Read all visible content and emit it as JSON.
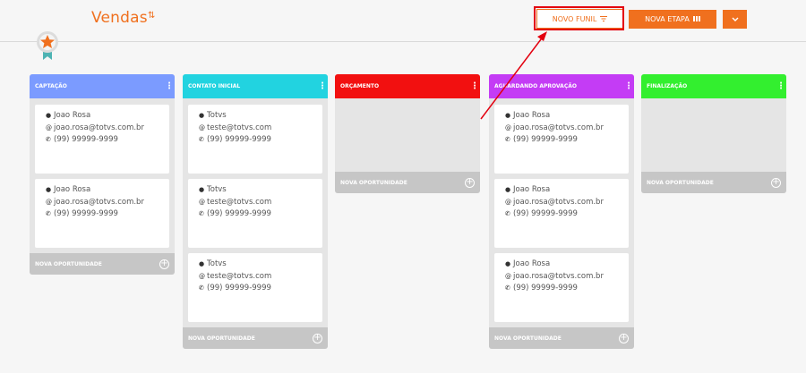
{
  "header": {
    "title": "Vendas",
    "sort_icon": "sort-arrows-icon",
    "btn_novo_funil": "NOVO FUNIL",
    "btn_novo_funil_icon": "filter-icon",
    "btn_nova_etapa": "NOVA ETAPA",
    "btn_nova_etapa_icon": "columns-icon",
    "btn_more_icon": "chevron-down-icon"
  },
  "colors": {
    "accent": "#f0701e",
    "highlight": "#e3000f",
    "captacao": "#7b9bff",
    "contato": "#22d3e0",
    "orcamento": "#f21010",
    "aguardando": "#c43cf5",
    "finalizacao": "#33ef2f"
  },
  "columns": [
    {
      "title": "CAPTAÇÃO",
      "footer": "NOVA OPORTUNIDADE",
      "cards": [
        {
          "name": "Joao Rosa",
          "email": "joao.rosa@totvs.com.br",
          "phone": "(99) 99999-9999"
        },
        {
          "name": "Joao Rosa",
          "email": "joao.rosa@totvs.com.br",
          "phone": "(99) 99999-9999"
        }
      ]
    },
    {
      "title": "CONTATO INICIAL",
      "footer": "NOVA OPORTUNIDADE",
      "cards": [
        {
          "name": "Totvs",
          "email": "teste@totvs.com",
          "phone": "(99) 99999-9999"
        },
        {
          "name": "Totvs",
          "email": "teste@totvs.com",
          "phone": "(99) 99999-9999"
        },
        {
          "name": "Totvs",
          "email": "teste@totvs.com",
          "phone": "(99) 99999-9999"
        }
      ]
    },
    {
      "title": "ORÇAMENTO",
      "footer": "NOVA OPORTUNIDADE",
      "cards": []
    },
    {
      "title": "AGUARDANDO APROVAÇÃO",
      "footer": "NOVA OPORTUNIDADE",
      "cards": [
        {
          "name": "Joao Rosa",
          "email": "joao.rosa@totvs.com.br",
          "phone": "(99) 99999-9999"
        },
        {
          "name": "Joao Rosa",
          "email": "joao.rosa@totvs.com.br",
          "phone": "(99) 99999-9999"
        },
        {
          "name": "Joao Rosa",
          "email": "joao.rosa@totvs.com.br",
          "phone": "(99) 99999-9999"
        }
      ]
    },
    {
      "title": "FINALIZAÇÃO",
      "footer": "NOVA OPORTUNIDADE",
      "cards": []
    }
  ]
}
